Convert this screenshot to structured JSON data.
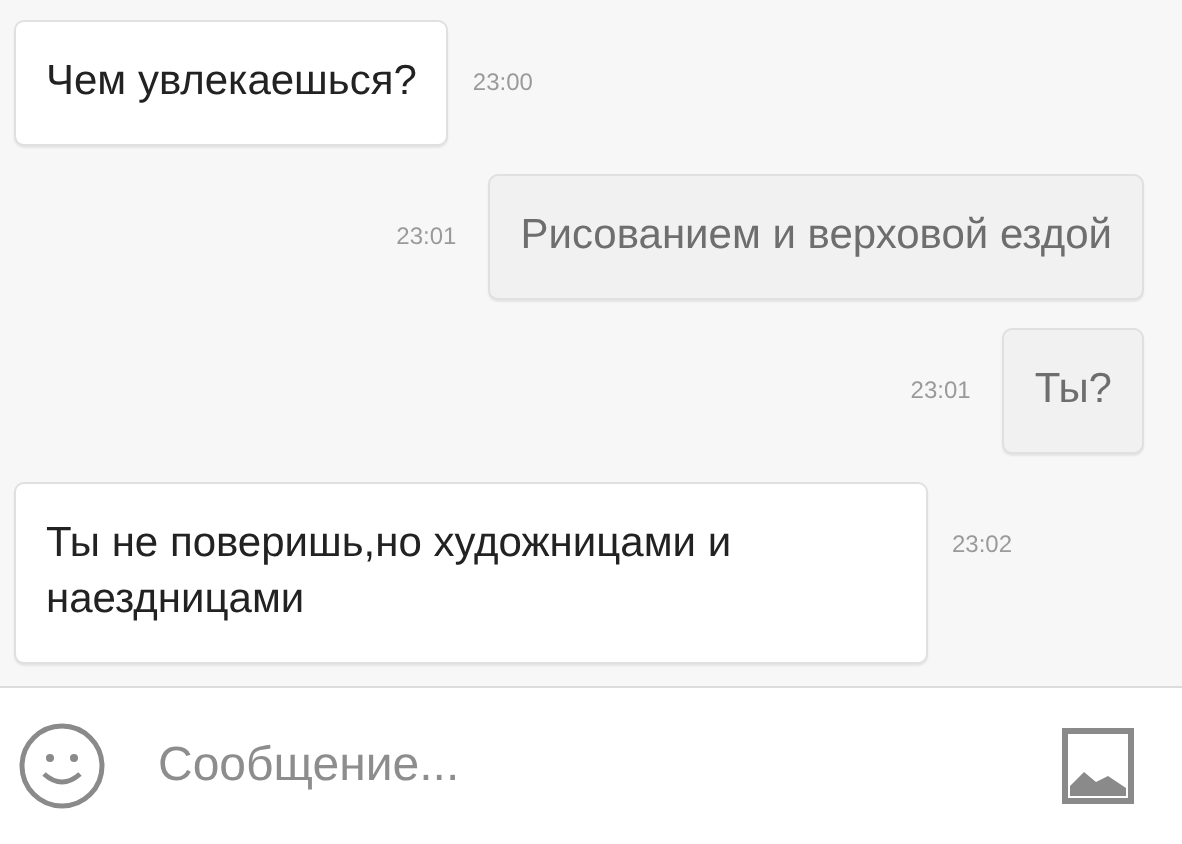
{
  "messages": [
    {
      "kind": "incoming",
      "text": "Чем увлекаешься?",
      "time": "23:00"
    },
    {
      "kind": "outgoing",
      "text": "Рисованием и верховой ездой",
      "time": "23:01"
    },
    {
      "kind": "outgoing",
      "text": "Ты?",
      "time": "23:01"
    },
    {
      "kind": "incoming",
      "text": "Ты не поверишь,но художницами и наездницами",
      "time": "23:02"
    }
  ],
  "composer": {
    "placeholder": "Сообщение..."
  }
}
